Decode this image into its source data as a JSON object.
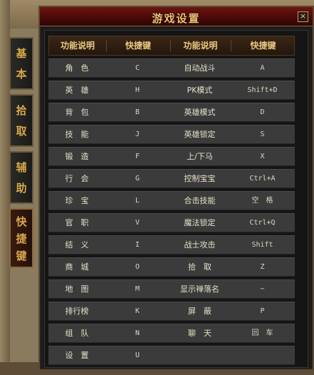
{
  "window": {
    "title": "游戏设置",
    "close": "×"
  },
  "tabs": [
    {
      "chars": [
        "基",
        "本"
      ]
    },
    {
      "chars": [
        "拾",
        "取"
      ]
    },
    {
      "chars": [
        "辅",
        "助"
      ]
    },
    {
      "chars": [
        "快",
        "捷",
        "键"
      ]
    }
  ],
  "headers": [
    "功能说明",
    "快捷键",
    "功能说明",
    "快捷键"
  ],
  "rows": [
    [
      "角　色",
      "C",
      "自动战斗",
      "A"
    ],
    [
      "英　雄",
      "H",
      "PK模式",
      "Shift+D"
    ],
    [
      "背　包",
      "B",
      "英雄模式",
      "D"
    ],
    [
      "技　能",
      "J",
      "英雄锁定",
      "S"
    ],
    [
      "锻　造",
      "F",
      "上/下马",
      "X"
    ],
    [
      "行　会",
      "G",
      "控制宝宝",
      "Ctrl+A"
    ],
    [
      "珍　宝",
      "L",
      "合击技能",
      "空　格"
    ],
    [
      "官　职",
      "V",
      "魔法锁定",
      "Ctrl+Q"
    ],
    [
      "结　义",
      "I",
      "战士攻击",
      "Shift"
    ],
    [
      "商　城",
      "O",
      "拾　取",
      "Z"
    ],
    [
      "地　图",
      "M",
      "显示禅落名",
      "~"
    ],
    [
      "排行榜",
      "K",
      "屏　蔽",
      "P"
    ],
    [
      "组　队",
      "N",
      "聊　天",
      "回　车"
    ],
    [
      "设　置",
      "U",
      "",
      ""
    ]
  ]
}
